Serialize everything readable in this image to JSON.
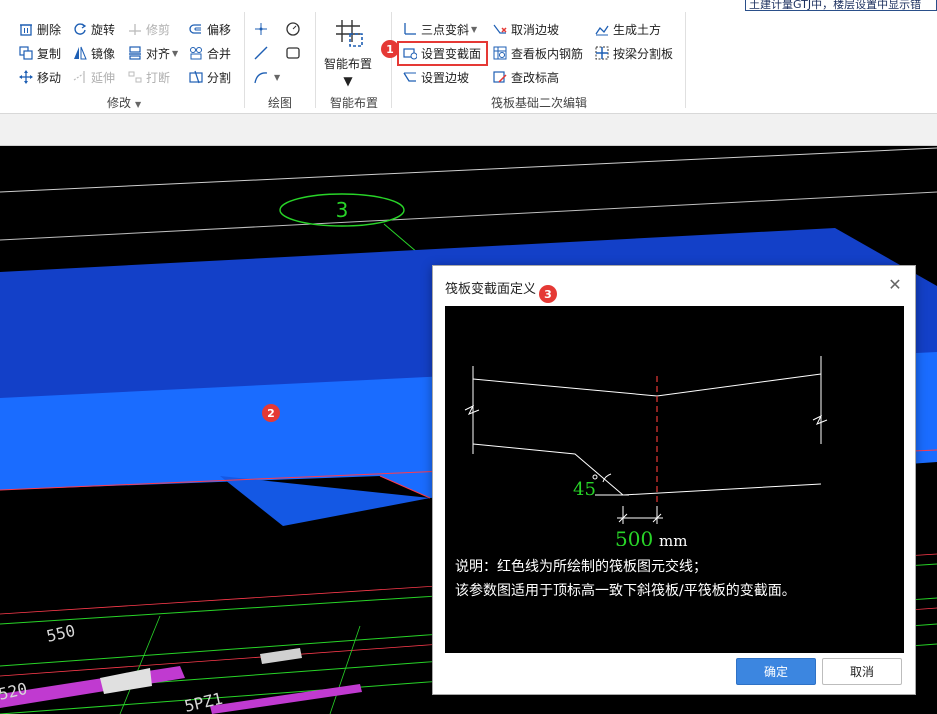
{
  "notice": "土建计量GTJ中，楼层设置中显示错",
  "ribbon": {
    "modify": {
      "items": [
        {
          "label": "删除",
          "icon": "delete-icon",
          "enabled": true
        },
        {
          "label": "旋转",
          "icon": "rotate-icon",
          "enabled": true
        },
        {
          "label": "修剪",
          "icon": "trim-icon",
          "enabled": false
        },
        {
          "label": "偏移",
          "icon": "offset-icon",
          "enabled": true
        },
        {
          "label": "复制",
          "icon": "copy-icon",
          "enabled": true
        },
        {
          "label": "镜像",
          "icon": "mirror-icon",
          "enabled": true
        },
        {
          "label": "对齐",
          "icon": "align-icon",
          "enabled": true
        },
        {
          "label": "合并",
          "icon": "merge-icon",
          "enabled": true
        },
        {
          "label": "移动",
          "icon": "move-icon",
          "enabled": true
        },
        {
          "label": "延伸",
          "icon": "extend-icon",
          "enabled": false
        },
        {
          "label": "打断",
          "icon": "break-icon",
          "enabled": false
        },
        {
          "label": "分割",
          "icon": "split-icon",
          "enabled": true
        }
      ],
      "group_label": "修改"
    },
    "draw": {
      "group_label": "绘图"
    },
    "smart": {
      "label": "智能布置",
      "group_label": "智能布置"
    },
    "raft": {
      "items": [
        {
          "label": "三点变斜",
          "icon": "three-point-slope-icon"
        },
        {
          "label": "取消边坡",
          "icon": "cancel-slope-icon"
        },
        {
          "label": "生成土方",
          "icon": "generate-earthwork-icon"
        },
        {
          "label": "设置变截面",
          "icon": "set-variable-section-icon"
        },
        {
          "label": "查看板内钢筋",
          "icon": "view-rebar-icon"
        },
        {
          "label": "按梁分割板",
          "icon": "split-by-beam-icon"
        },
        {
          "label": "设置边坡",
          "icon": "set-slope-icon"
        },
        {
          "label": "查改标高",
          "icon": "edit-elevation-icon"
        }
      ],
      "group_label": "筏板基础二次编辑"
    }
  },
  "badges": [
    "1",
    "2",
    "3"
  ],
  "canvas": {
    "axis_label": "3",
    "dims": [
      "550",
      "520",
      "5PZ1"
    ]
  },
  "dialog": {
    "title": "筏板变截面定义",
    "angle": "45",
    "width_value": "500",
    "width_unit": "mm",
    "note_line1": "说明：红色线为所绘制的筏板图元交线；",
    "note_line2": "该参数图适用于顶标高一致下斜筏板/平筏板的变截面。",
    "ok": "确定",
    "cancel": "取消"
  },
  "colors": {
    "highlight": "#e53935",
    "raft_blue": "#1a6cff",
    "primary_button": "#3c86e0"
  }
}
